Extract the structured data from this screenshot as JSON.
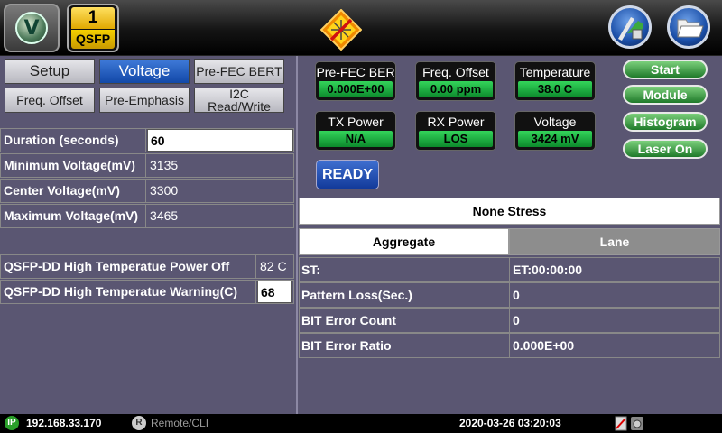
{
  "header": {
    "logo_letter": "V",
    "port_number": "1",
    "port_label": "QSFP"
  },
  "tabs": [
    {
      "label": "Setup"
    },
    {
      "label": "Voltage"
    },
    {
      "label": "Pre-FEC BERT"
    },
    {
      "label": "Freq. Offset"
    },
    {
      "label": "Pre-Emphasis"
    },
    {
      "label": "I2C Read/Write"
    }
  ],
  "voltage_params": [
    {
      "name": "Duration (seconds)",
      "value": "60"
    },
    {
      "name": "Minimum Voltage(mV)",
      "value": "3135"
    },
    {
      "name": "Center Voltage(mV)",
      "value": "3300"
    },
    {
      "name": "Maximum Voltage(mV)",
      "value": "3465"
    }
  ],
  "temperature_params": [
    {
      "name": "QSFP-DD High Temperatue Power Off",
      "value": "82 C"
    },
    {
      "name": "QSFP-DD High Temperatue Warning(C)",
      "value": "68"
    }
  ],
  "meters": [
    {
      "title": "Pre-FEC BER",
      "value": "0.000E+00"
    },
    {
      "title": "Freq. Offset",
      "value": "0.00 ppm"
    },
    {
      "title": "Temperature",
      "value": "38.0 C"
    },
    {
      "title": "TX Power",
      "value": "N/A"
    },
    {
      "title": "RX Power",
      "value": "LOS"
    },
    {
      "title": "Voltage",
      "value": "3424 mV"
    }
  ],
  "actions": {
    "start": "Start",
    "module": "Module",
    "histogram": "Histogram",
    "laser": "Laser On"
  },
  "status": {
    "ready": "READY",
    "stress": "None Stress"
  },
  "results_tabs": {
    "aggregate": "Aggregate",
    "lane": "Lane"
  },
  "results": [
    {
      "name": "ST:",
      "value": "ET:00:00:00"
    },
    {
      "name": "Pattern Loss(Sec.)",
      "value": "0"
    },
    {
      "name": "BIT Error Count",
      "value": "0"
    },
    {
      "name": "BIT Error Ratio",
      "value": "0.000E+00"
    }
  ],
  "statusbar": {
    "ip_icon": "IP",
    "ip": "192.168.33.170",
    "remote_icon": "R",
    "remote": "Remote/CLI",
    "datetime": "2020-03-26  03:20:03"
  },
  "colors": {
    "accent": "#1248a8",
    "meter_green": "#0c8a2c",
    "panel": "#5a5672"
  }
}
